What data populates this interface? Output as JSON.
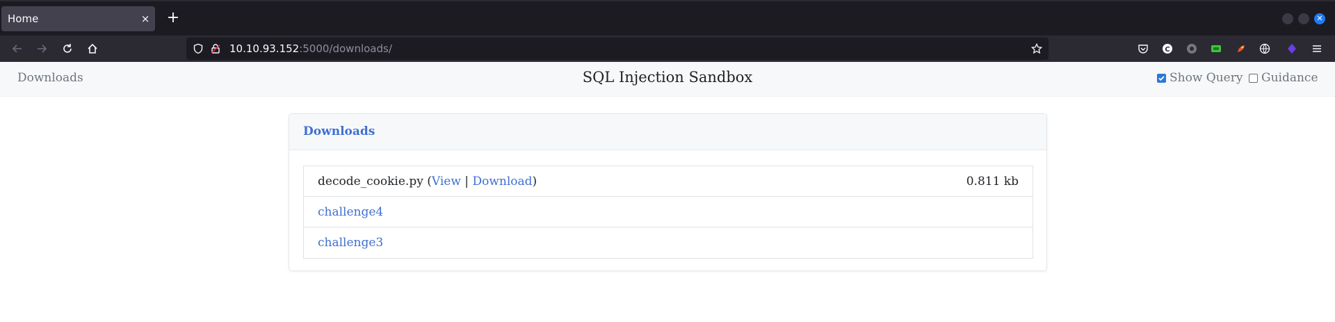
{
  "browser": {
    "tab_title": "Home",
    "tab_close": "×",
    "new_tab": "+",
    "url_host": "10.10.93.152",
    "url_path": ":5000/downloads/"
  },
  "header": {
    "nav_link": "Downloads",
    "brand": "SQL Injection Sandbox",
    "show_query": "Show Query",
    "show_query_checked": true,
    "guidance": "Guidance",
    "guidance_checked": false
  },
  "card": {
    "title": "Downloads",
    "files": [
      {
        "name": "decode_cookie.py",
        "open_paren": " (",
        "view": "View",
        "sep": " | ",
        "download": "Download",
        "close_paren": ")",
        "size": "0.811 kb"
      },
      {
        "name": "challenge4"
      },
      {
        "name": "challenge3"
      }
    ]
  },
  "colors": {
    "link": "#3f6fd1",
    "checkbox_accent": "#2f78d6",
    "chrome_dark": "#1c1b22"
  }
}
